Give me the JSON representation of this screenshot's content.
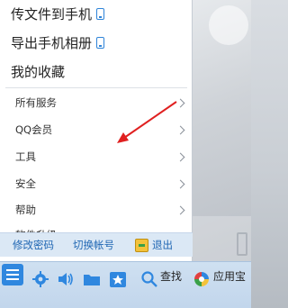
{
  "menu": {
    "top_items": [
      {
        "label": "传文件到手机",
        "icon": "phone-icon"
      },
      {
        "label": "导出手机相册",
        "icon": "phone-icon"
      },
      {
        "label": "我的收藏"
      }
    ],
    "sub_items": [
      {
        "label": "所有服务",
        "has_submenu": true
      },
      {
        "label": "QQ会员",
        "has_submenu": true
      },
      {
        "label": "工具",
        "has_submenu": true
      },
      {
        "label": "安全",
        "has_submenu": true
      },
      {
        "label": "帮助",
        "has_submenu": true
      },
      {
        "label": "软件升级",
        "has_submenu": false
      }
    ],
    "actions": {
      "change_password": "修改密码",
      "switch_account": "切换帐号",
      "exit": "退出"
    }
  },
  "taskbar": {
    "icons": [
      "menu-icon",
      "gear-icon",
      "speaker-icon",
      "folder-icon",
      "star-icon",
      "search-icon",
      "app-store-icon"
    ],
    "search_label": "查找",
    "app_store_label": "应用宝"
  },
  "colors": {
    "accent": "#2f87df",
    "link": "#1f66b3",
    "annotation_arrow": "#e02020"
  }
}
